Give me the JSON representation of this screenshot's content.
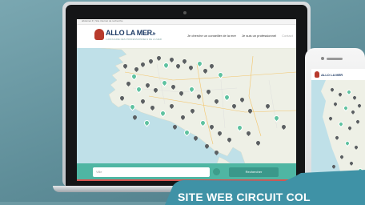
{
  "site": {
    "url_strip": "allolamer.fr  |  Site internet de recherche",
    "logo_text": "ALLO LA MER",
    "logo_suffix": ".fr",
    "logo_subtitle": "L'ANNUAIRE DES PROFESSIONNELS DE LA MER",
    "nav_items": [
      {
        "label": "Je cherche un conseiller de la mer"
      },
      {
        "label": "Je suis un professionnel"
      },
      {
        "label": "Contact"
      }
    ]
  },
  "search": {
    "placeholder": "Ville",
    "button_label": "Rechercher"
  },
  "phone": {
    "logo_text": "ALLO LA MER"
  },
  "banner": {
    "text": "SITE WEB CIRCUIT COL"
  },
  "colors": {
    "background": "#6c99a3",
    "map_water": "#bfe0e8",
    "map_land": "#eef0e6",
    "pin_dark": "#5b5f62",
    "pin_green": "#5fc2a0",
    "search_bar": "#4fb6a3",
    "banner": "#3f92a6",
    "logo_red": "#b83a2c",
    "logo_navy": "#1e3b66"
  },
  "icons": {
    "map_pin": "map-pin-icon",
    "location": "location-target-icon",
    "logo": "lighthouse-logo-icon"
  }
}
